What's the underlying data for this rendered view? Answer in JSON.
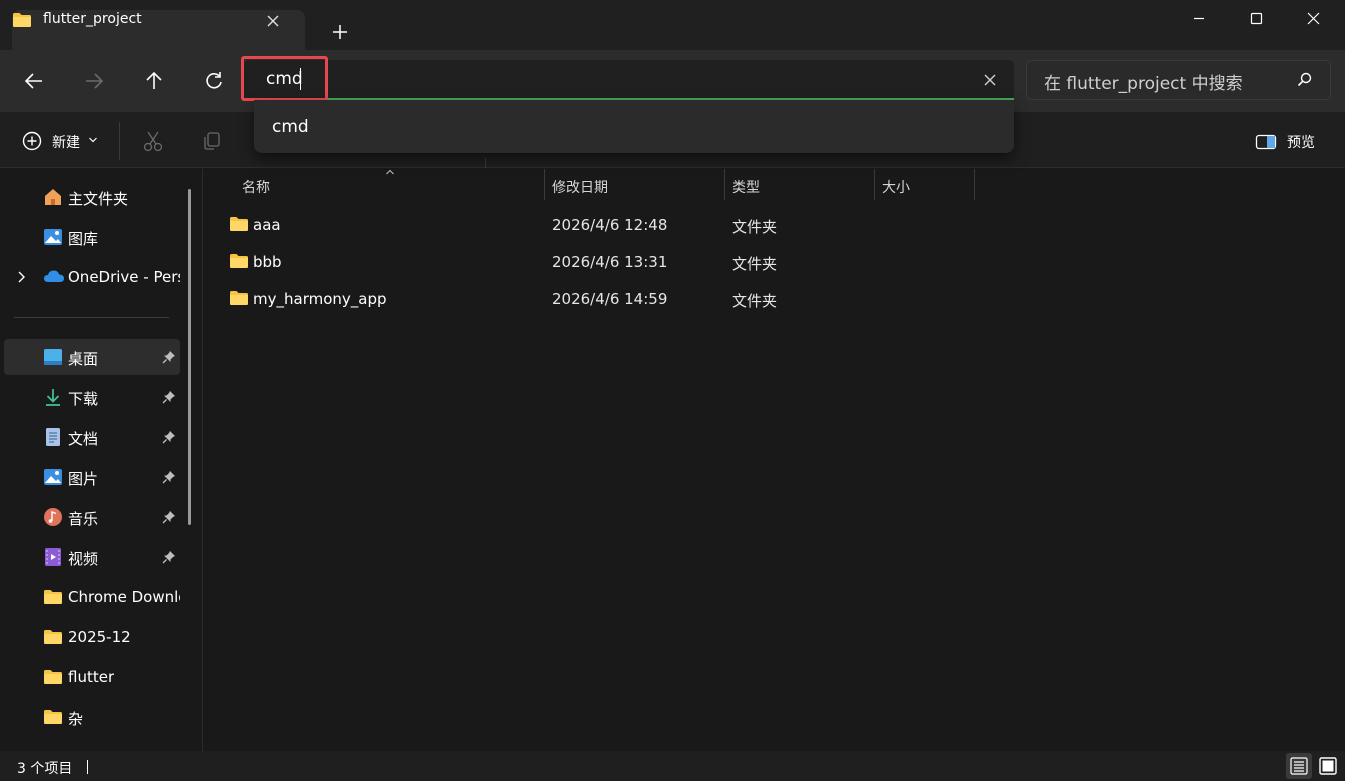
{
  "window": {
    "tab_title": "flutter_project"
  },
  "address": {
    "value": "cmd",
    "suggestion": "cmd"
  },
  "search": {
    "placeholder": "在 flutter_project 中搜索"
  },
  "toolbar": {
    "new_label": "新建",
    "preview_label": "预览"
  },
  "sidebar": {
    "items": [
      {
        "label": "主文件夹",
        "icon": "home-icon",
        "pinned": false
      },
      {
        "label": "图库",
        "icon": "gallery-icon",
        "pinned": false
      },
      {
        "label": "OneDrive - Pers",
        "icon": "onedrive-icon",
        "pinned": false,
        "expandable": true
      },
      {
        "label": "桌面",
        "icon": "desktop-icon",
        "pinned": true,
        "selected": true
      },
      {
        "label": "下载",
        "icon": "download-icon",
        "pinned": true
      },
      {
        "label": "文档",
        "icon": "document-icon",
        "pinned": true
      },
      {
        "label": "图片",
        "icon": "pictures-icon",
        "pinned": true
      },
      {
        "label": "音乐",
        "icon": "music-icon",
        "pinned": true
      },
      {
        "label": "视频",
        "icon": "video-icon",
        "pinned": true
      },
      {
        "label": "Chrome Downlo",
        "icon": "folder-icon",
        "pinned": false
      },
      {
        "label": "2025-12",
        "icon": "folder-icon",
        "pinned": false
      },
      {
        "label": "flutter",
        "icon": "folder-icon",
        "pinned": false
      },
      {
        "label": "杂",
        "icon": "folder-icon",
        "pinned": false
      }
    ]
  },
  "columns": {
    "name": "名称",
    "modified": "修改日期",
    "type": "类型",
    "size": "大小"
  },
  "files": [
    {
      "name": "aaa",
      "modified": "2026/4/6 12:48",
      "type": "文件夹"
    },
    {
      "name": "bbb",
      "modified": "2026/4/6 13:31",
      "type": "文件夹"
    },
    {
      "name": "my_harmony_app",
      "modified": "2026/4/6 14:59",
      "type": "文件夹"
    }
  ],
  "status": {
    "item_count": "3 个项目"
  },
  "colors": {
    "background": "#191919",
    "titlebar": "#202020",
    "address_row": "#2c2c2c",
    "accent_underline": "#4aa55b",
    "highlight": "#e5484d",
    "folder": "#f6c342"
  }
}
